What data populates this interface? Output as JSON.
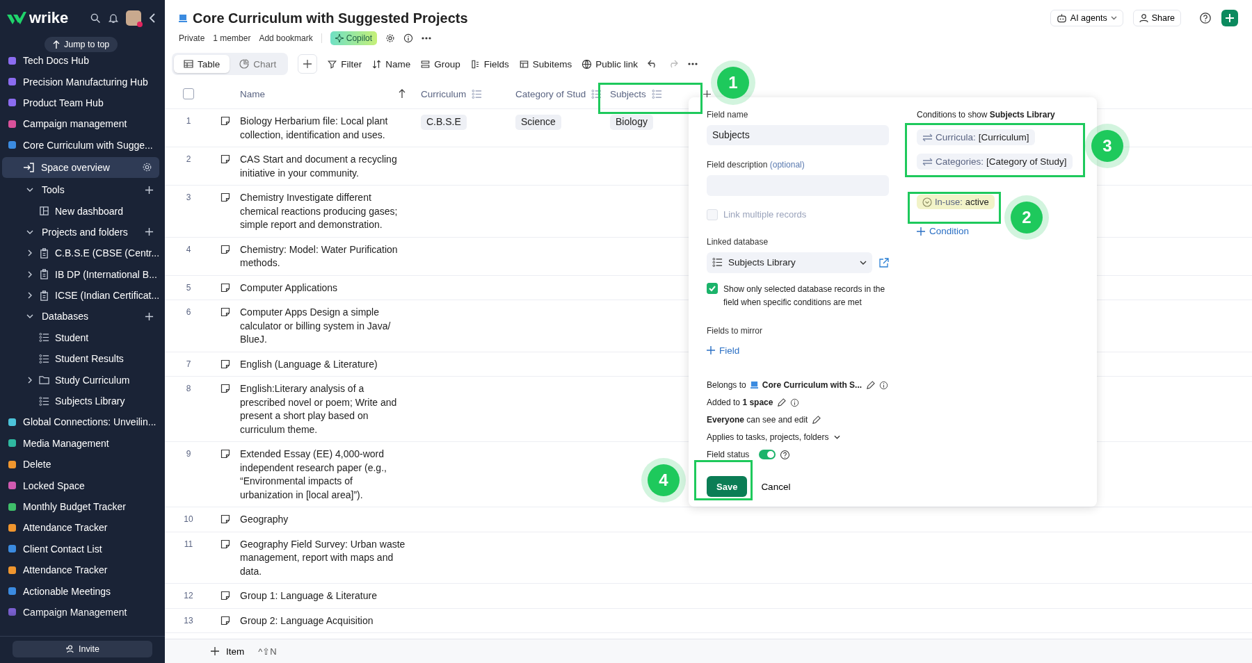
{
  "sidebar": {
    "logo": "wrike",
    "jump_tooltip": "Jump to top",
    "items": [
      {
        "label": "Tech Docs Hub",
        "color": "#8b6cf0",
        "selected": false
      },
      {
        "label": "Precision Manufacturing Hub",
        "color": "#8b6cf0",
        "selected": false
      },
      {
        "label": "Product Team Hub",
        "color": "#8b6cf0",
        "selected": false
      },
      {
        "label": "Campaign management",
        "color": "#d9519a",
        "selected": false
      },
      {
        "label": "Core Curriculum with Sugge...",
        "color": "#3b8be0",
        "selected": false,
        "children": [
          {
            "label": "Space overview",
            "kind": "overview",
            "selected": true
          },
          {
            "label": "Tools",
            "kind": "section",
            "expanded": true,
            "selected": false,
            "children": [
              {
                "label": "New dashboard",
                "kind": "dashboard",
                "selected": false
              }
            ]
          },
          {
            "label": "Projects and folders",
            "kind": "section",
            "expanded": true,
            "selected": false,
            "children": [
              {
                "label": "C.B.S.E (CBSE (Centr...",
                "kind": "project",
                "expanded": false,
                "selected": false
              },
              {
                "label": "IB DP (International B...",
                "kind": "project",
                "expanded": false,
                "selected": false
              },
              {
                "label": "ICSE (Indian Certificat...",
                "kind": "project",
                "expanded": false,
                "selected": false
              }
            ]
          },
          {
            "label": "Databases",
            "kind": "section",
            "expanded": true,
            "selected": false,
            "children": [
              {
                "label": "Student",
                "kind": "database",
                "selected": false
              },
              {
                "label": "Student Results",
                "kind": "database",
                "selected": false
              },
              {
                "label": "Study Curriculum",
                "kind": "folder",
                "expanded": false,
                "selected": false
              },
              {
                "label": "Subjects Library",
                "kind": "database",
                "selected": false
              }
            ]
          }
        ]
      },
      {
        "label": "Global Connections: Unveilin...",
        "color": "#4cc3d9",
        "selected": false
      },
      {
        "label": "Media Management",
        "color": "#2fb8a0",
        "selected": false
      },
      {
        "label": "Delete",
        "color": "#f0962e",
        "selected": false
      },
      {
        "label": "Locked Space",
        "color": "#d05ab0",
        "selected": false
      },
      {
        "label": "Monthly Budget Tracker",
        "color": "#3fbf6a",
        "selected": false
      },
      {
        "label": "Attendance Tracker",
        "color": "#f0962e",
        "selected": false
      },
      {
        "label": "Client Contact List",
        "color": "#3b8be0",
        "selected": false
      },
      {
        "label": "Attendance Tracker",
        "color": "#f0962e",
        "selected": false
      },
      {
        "label": "Actionable Meetings",
        "color": "#3b8be0",
        "selected": false
      },
      {
        "label": "Campaign Management",
        "color": "#7a5fd0",
        "selected": false
      }
    ],
    "invite": "Invite"
  },
  "header": {
    "title": "Core Curriculum with Suggested Projects",
    "meta": [
      "Private",
      "1 member",
      "Add bookmark"
    ],
    "copilot": "Copilot",
    "ai_agents": "AI agents",
    "share": "Share"
  },
  "toolbar": {
    "tabs": [
      {
        "label": "Table",
        "selected": true
      },
      {
        "label": "Chart",
        "selected": false
      }
    ],
    "actions": [
      "Filter",
      "Name",
      "Group",
      "Fields",
      "Subitems",
      "Public link"
    ]
  },
  "table": {
    "select_all_checked": false,
    "columns": [
      "Name",
      "Curriculum",
      "Category of Stud",
      "Subjects"
    ],
    "rows": [
      {
        "number": "1",
        "name": "Biology Herbarium file: Local plant collection, identification and uses.",
        "curriculum": "C.B.S.E",
        "category": "Science",
        "subjects": "Biology"
      },
      {
        "number": "2",
        "name": "CAS Start and document a recycling initiative in your community."
      },
      {
        "number": "3",
        "name": "Chemistry Investigate different chemical reactions producing gases; simple report and demonstration."
      },
      {
        "number": "4",
        "name": "Chemistry: Model: Water Purification methods."
      },
      {
        "number": "5",
        "name": "Computer Applications"
      },
      {
        "number": "6",
        "name": "Computer Apps Design a simple calculator or billing system in Java/ BlueJ."
      },
      {
        "number": "7",
        "name": "English (Language & Literature)"
      },
      {
        "number": "8",
        "name": "English:Literary analysis of a prescribed novel or poem; Write and present a short play based on curriculum theme."
      },
      {
        "number": "9",
        "name": "Extended Essay (EE) 4,000-word independent research paper (e.g., “Environmental impacts of urbanization in [local area]”)."
      },
      {
        "number": "10",
        "name": "Geography"
      },
      {
        "number": "11",
        "name": "Geography Field Survey: Urban waste management, report with maps and data."
      },
      {
        "number": "12",
        "name": "Group 1: Language & Literature"
      },
      {
        "number": "13",
        "name": "Group 2: Language Acquisition"
      }
    ]
  },
  "footer": {
    "add_item": "Item",
    "shortcut": "^⇧N"
  },
  "field_panel": {
    "field_name_label": "Field name",
    "field_name": "Subjects",
    "description_label": "Field description",
    "description_optional": "(optional)",
    "link_multiple": {
      "label": "Link multiple records",
      "checked": false,
      "disabled": true
    },
    "linked_database_label": "Linked database",
    "linked_database": "Subjects Library",
    "show_only": {
      "label": "Show only selected database records in the field when specific conditions are met",
      "checked": true
    },
    "fields_to_mirror_label": "Fields to mirror",
    "add_field": "Field",
    "belongs_to_label": "Belongs to",
    "belongs_to": "Core Curriculum with S...",
    "added_to": "Added to **1 space**",
    "permissions": "**Everyone** can see and edit",
    "applies_to": "Applies to tasks, projects, folders",
    "field_status_label": "Field status",
    "field_status_on": true,
    "save": "Save",
    "cancel": "Cancel",
    "conditions_title": "Conditions to show **Subjects Library**",
    "conditions": [
      {
        "key": "Curricula:",
        "value": "[Curriculum]"
      },
      {
        "key": "Categories:",
        "value": "[Category of Study]"
      }
    ],
    "in_use": {
      "key": "In-use:",
      "value": "active"
    },
    "add_condition": "Condition"
  },
  "callouts": [
    "1",
    "2",
    "3",
    "4"
  ]
}
